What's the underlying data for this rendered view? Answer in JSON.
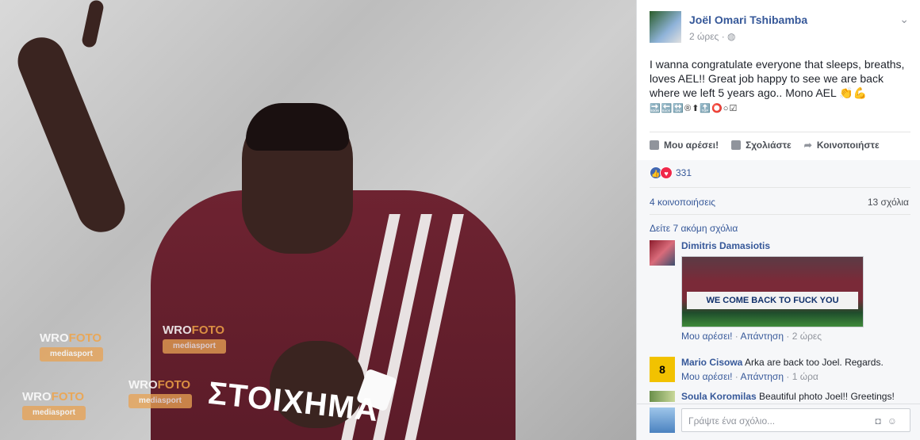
{
  "photo": {
    "watermarks": [
      {
        "wro": "WRO",
        "foto": "FOTO",
        "media": "mediasport"
      },
      {
        "wro": "WRO",
        "foto": "FOTO",
        "media": "mediasport"
      },
      {
        "wro": "WRO",
        "foto": "FOTO",
        "media": "mediasport"
      },
      {
        "wro": "WRO",
        "foto": "FOTO",
        "media": "mediasport"
      }
    ],
    "sponsor_text": "ΣΤΟΙΧΗΜΑ"
  },
  "post": {
    "author": "Joël Omari Tshibamba",
    "time": "2 ώρες",
    "privacy_icon": "globe-icon",
    "text": "I wanna congratulate everyone that sleeps, breaths, loves AEL!! Great job happy to see we are back where we left 5 years ago.. Mono AEL 👏💪",
    "emoji_line": "🔜🔙🔛®⬆🔝⭕○☑"
  },
  "actions": {
    "like": "Μου αρέσει!",
    "comment": "Σχολιάστε",
    "share": "Κοινοποιήστε"
  },
  "stats": {
    "reaction_count": "331",
    "shares": "4 κοινοποιήσεις",
    "comments": "13 σχόλια",
    "more_comments": "Δείτε 7 ακόμη σχόλια"
  },
  "comments": [
    {
      "name": "Dimitris Damasiotis",
      "text": "",
      "image_banner": "WE COME BACK TO FUCK YOU",
      "like": "Μου αρέσει!",
      "reply": "Απάντηση",
      "time": "2 ώρες"
    },
    {
      "name": "Mario Cisowa",
      "text": "Arka are back too Joel. Regards.",
      "like": "Μου αρέσει!",
      "reply": "Απάντηση",
      "time": "1 ώρα"
    },
    {
      "name": "Soula Koromilas",
      "text": "Beautiful photo Joel!! Greetings!"
    }
  ],
  "composer": {
    "placeholder": "Γράψτε ένα σχόλιο..."
  },
  "colors": {
    "link": "#365899",
    "muted": "#90949c",
    "like_blue": "#4267b2",
    "love_red": "#f0284a"
  }
}
